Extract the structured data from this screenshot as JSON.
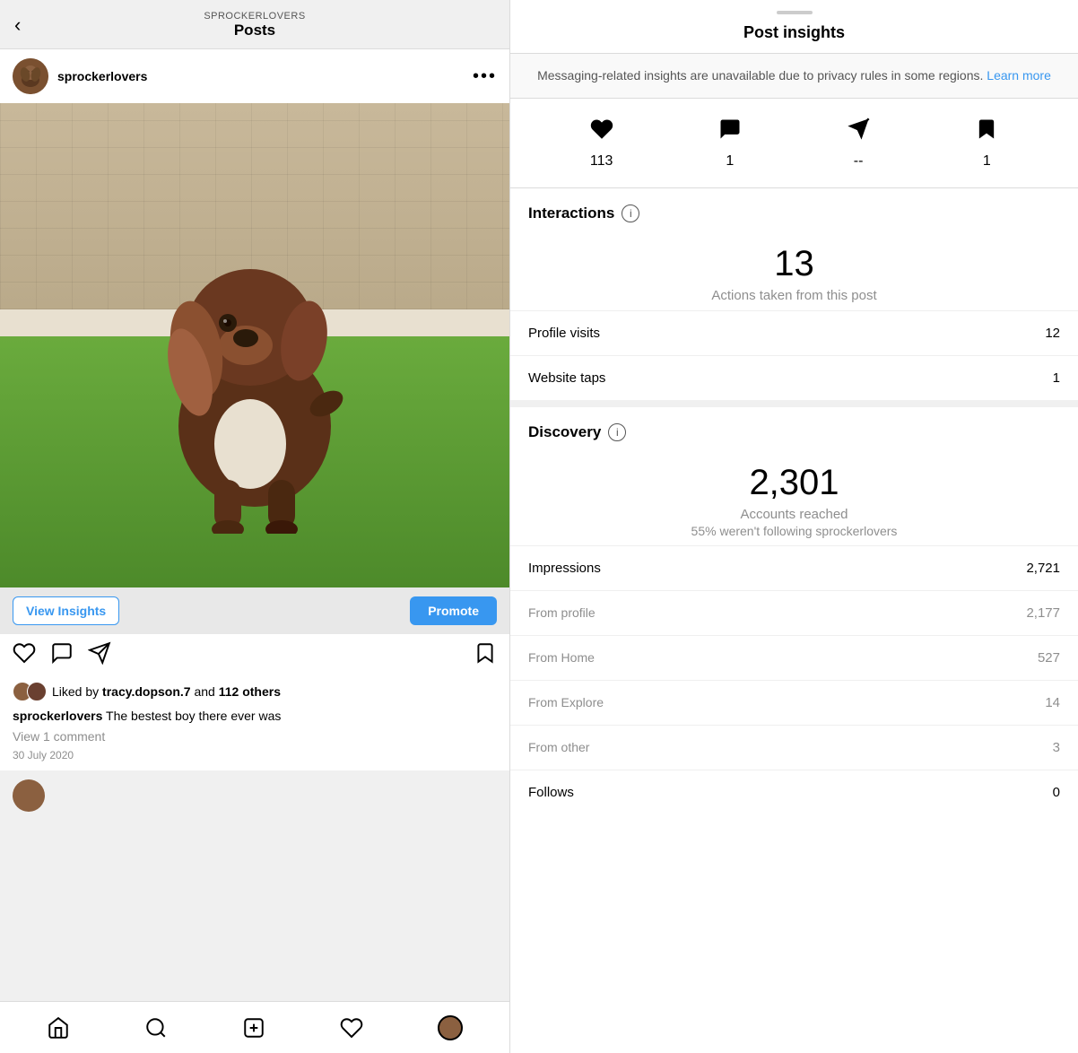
{
  "left": {
    "header": {
      "username_small": "SPROCKERLOVERS",
      "page_title": "Posts",
      "back_icon": "‹"
    },
    "post_header": {
      "username": "sprockerlovers",
      "more_icon": "•••"
    },
    "action_bar": {
      "view_insights_label": "View Insights",
      "promote_label": "Promote"
    },
    "likes": {
      "text": "Liked by",
      "liker": "tracy.dopson.7",
      "and_text": "and",
      "others": "112 others"
    },
    "caption": {
      "username": "sprockerlovers",
      "text": "The bestest boy there ever was"
    },
    "comments": "View 1 comment",
    "date": "30 July 2020",
    "bottom_nav": {
      "home": "⌂",
      "search": "○",
      "add": "⊕",
      "heart": "♡"
    }
  },
  "right": {
    "drag_handle": true,
    "title": "Post insights",
    "privacy_notice": {
      "text": "Messaging-related insights are unavailable due to privacy rules in some regions.",
      "link_text": "Learn more"
    },
    "metrics": [
      {
        "icon": "heart",
        "value": "113"
      },
      {
        "icon": "comment",
        "value": "1"
      },
      {
        "icon": "send",
        "value": "--"
      },
      {
        "icon": "bookmark",
        "value": "1"
      }
    ],
    "interactions": {
      "section_title": "Interactions",
      "big_number": "13",
      "big_subtitle": "Actions taken from this post",
      "rows": [
        {
          "label": "Profile visits",
          "value": "12"
        },
        {
          "label": "Website taps",
          "value": "1"
        }
      ]
    },
    "discovery": {
      "section_title": "Discovery",
      "big_number": "2,301",
      "big_subtitle": "Accounts reached",
      "big_subtitle2": "55% weren't following sprockerlovers",
      "rows": [
        {
          "label": "Impressions",
          "value": "2,721",
          "sub": false
        },
        {
          "label": "From profile",
          "value": "2,177",
          "sub": true
        },
        {
          "label": "From Home",
          "value": "527",
          "sub": true
        },
        {
          "label": "From Explore",
          "value": "14",
          "sub": true
        },
        {
          "label": "From other",
          "value": "3",
          "sub": true
        },
        {
          "label": "Follows",
          "value": "0",
          "sub": false
        }
      ]
    }
  }
}
